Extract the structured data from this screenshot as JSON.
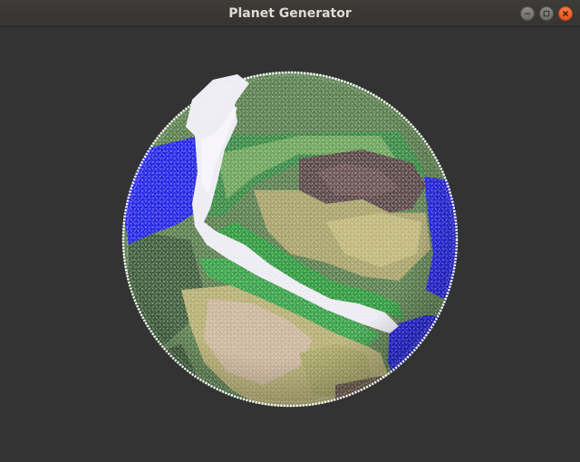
{
  "window": {
    "title": "Planet Generator",
    "controls": [
      {
        "name": "minimize-button",
        "icon": "minimize-icon"
      },
      {
        "name": "maximize-button",
        "icon": "maximize-icon"
      },
      {
        "name": "close-button",
        "icon": "close-icon"
      }
    ]
  },
  "viewport": {
    "background_color": "#333333",
    "planet": {
      "render_style": "triangle-mesh point cloud",
      "colors": {
        "ocean": "#1a1ae6",
        "snow": "#f2eef6",
        "forest": "#2f9a3e",
        "grassland": "#6fa85c",
        "lowland_dark": "#3f5a3c",
        "desert": "#b9b47a",
        "sand": "#cdb79a",
        "mountain": "#5e4a4a",
        "rim": "#ffffff"
      }
    }
  }
}
